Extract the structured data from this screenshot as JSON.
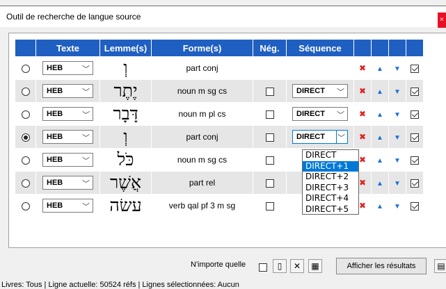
{
  "window": {
    "title": "Outil de recherche de langue source",
    "close_glyph": "×"
  },
  "table": {
    "headers": [
      "",
      "Texte",
      "Lemme(s)",
      "Forme(s)",
      "Nég.",
      "Séquence",
      "",
      "",
      "",
      ""
    ],
    "rows": [
      {
        "selected": false,
        "text": "HEB",
        "lemma": "וְ",
        "form": "part conj",
        "neg_shown": false,
        "neg": false,
        "seq": "",
        "include": true
      },
      {
        "selected": false,
        "text": "HEB",
        "lemma": "יֶתֶר",
        "form": "noun m sg cs",
        "neg_shown": true,
        "neg": false,
        "seq": "DIRECT",
        "include": true
      },
      {
        "selected": false,
        "text": "HEB",
        "lemma": "דָּבָר",
        "form": "noun m pl cs",
        "neg_shown": true,
        "neg": false,
        "seq": "DIRECT",
        "include": true
      },
      {
        "selected": true,
        "text": "HEB",
        "lemma": "וְ",
        "form": "part conj",
        "neg_shown": true,
        "neg": false,
        "seq": "DIRECT",
        "include": true
      },
      {
        "selected": false,
        "text": "HEB",
        "lemma": "כֹּל",
        "form": "noun m sg cs",
        "neg_shown": true,
        "neg": false,
        "seq": "",
        "include": true
      },
      {
        "selected": false,
        "text": "HEB",
        "lemma": "אֲשֶׁר",
        "form": "part rel",
        "neg_shown": true,
        "neg": false,
        "seq": "",
        "include": true
      },
      {
        "selected": false,
        "text": "HEB",
        "lemma": "עשׂה",
        "form": "verb qal pf 3 m sg",
        "neg_shown": true,
        "neg": false,
        "seq": "",
        "include": true
      }
    ]
  },
  "sequence_dropdown": {
    "options": [
      "DIRECT",
      "DIRECT+1",
      "DIRECT+2",
      "DIRECT+3",
      "DIRECT+4",
      "DIRECT+5"
    ],
    "highlighted": "DIRECT+1"
  },
  "icons": {
    "delete": "x-icon",
    "move_up": "triangle-up-icon",
    "move_down": "triangle-down-icon"
  },
  "colors": {
    "header_bg": "#1f5fc1",
    "delete_red": "#e02020",
    "arrow_blue": "#1b6fd8",
    "highlight": "#0078d7"
  },
  "bottom": {
    "any_label": "N'importe quelle",
    "results_button": "Afficher les résultats"
  },
  "status": "Livres: Tous | Ligne actuelle: 50524 réfs | Lignes sélectionnées: Aucun"
}
